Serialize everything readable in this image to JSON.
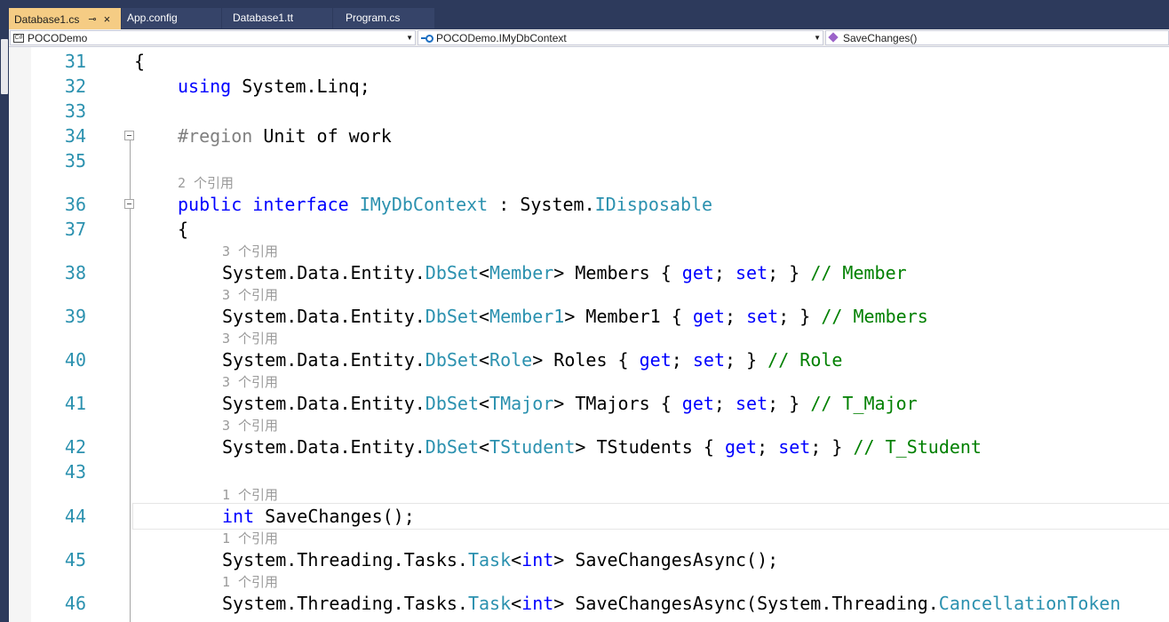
{
  "tabs": [
    {
      "label": "Database1.cs",
      "active": true
    },
    {
      "label": "App.config",
      "active": false
    },
    {
      "label": "Database1.tt",
      "active": false
    },
    {
      "label": "Program.cs",
      "active": false
    }
  ],
  "tab_icons": {
    "pin": "⊸",
    "close": "×"
  },
  "nav": {
    "project": {
      "icon": "C#",
      "label": "POCODemo"
    },
    "type": {
      "label": "POCODemo.IMyDbContext"
    },
    "member": {
      "label": "SaveChanges()"
    }
  },
  "lens": {
    "l36": "2 个引用",
    "l38": "3 个引用",
    "l39": "3 个引用",
    "l40": "3 个引用",
    "l41": "3 个引用",
    "l42": "3 个引用",
    "l44": "1 个引用",
    "l45": "1 个引用",
    "l46": "1 个引用"
  },
  "lines": {
    "l31": {
      "num": "31",
      "brace": "{"
    },
    "l32": {
      "num": "32",
      "kw": "using",
      "rest": " System.Linq;"
    },
    "l33": {
      "num": "33"
    },
    "l34": {
      "num": "34",
      "region": "#region",
      "rest": " Unit of work"
    },
    "l35": {
      "num": "35"
    },
    "l36": {
      "num": "36",
      "kw1": "public",
      "kw2": "interface",
      "name": "IMyDbContext",
      "sep": " : System.",
      "base": "IDisposable"
    },
    "l37": {
      "num": "37",
      "brace": "{"
    },
    "l38": {
      "num": "38",
      "ns": "System.Data.Entity.",
      "set": "DbSet",
      "lt": "<",
      "t": "Member",
      "gt": ">",
      "prop": " Members { ",
      "get": "get",
      "semi1": "; ",
      "setkw": "set",
      "semi2": "; } ",
      "comment": "// Member"
    },
    "l39": {
      "num": "39",
      "ns": "System.Data.Entity.",
      "set": "DbSet",
      "lt": "<",
      "t": "Member1",
      "gt": ">",
      "prop": " Member1 { ",
      "get": "get",
      "semi1": "; ",
      "setkw": "set",
      "semi2": "; } ",
      "comment": "// Members"
    },
    "l40": {
      "num": "40",
      "ns": "System.Data.Entity.",
      "set": "DbSet",
      "lt": "<",
      "t": "Role",
      "gt": ">",
      "prop": " Roles { ",
      "get": "get",
      "semi1": "; ",
      "setkw": "set",
      "semi2": "; } ",
      "comment": "// Role"
    },
    "l41": {
      "num": "41",
      "ns": "System.Data.Entity.",
      "set": "DbSet",
      "lt": "<",
      "t": "TMajor",
      "gt": ">",
      "prop": " TMajors { ",
      "get": "get",
      "semi1": "; ",
      "setkw": "set",
      "semi2": "; } ",
      "comment": "// T_Major"
    },
    "l42": {
      "num": "42",
      "ns": "System.Data.Entity.",
      "set": "DbSet",
      "lt": "<",
      "t": "TStudent",
      "gt": ">",
      "prop": " TStudents { ",
      "get": "get",
      "semi1": "; ",
      "setkw": "set",
      "semi2": "; } ",
      "comment": "// T_Student"
    },
    "l43": {
      "num": "43"
    },
    "l44": {
      "num": "44",
      "kw": "int",
      "rest": " SaveChanges();"
    },
    "l45": {
      "num": "45",
      "ns": "System.Threading.Tasks.",
      "task": "Task",
      "lt": "<",
      "kw": "int",
      "rest": "> SaveChangesAsync();"
    },
    "l46": {
      "num": "46",
      "ns": "System.Threading.Tasks.",
      "task": "Task",
      "lt": "<",
      "kw": "int",
      "rest": "> SaveChangesAsync(System.Threading.",
      "tok": "CancellationToken"
    }
  },
  "colors": {
    "keyword": "#0000ff",
    "type": "#2b91af",
    "comment": "#008000",
    "line_number": "#2b91af",
    "active_tab": "#f5cc84",
    "chrome": "#2d3a5c"
  }
}
